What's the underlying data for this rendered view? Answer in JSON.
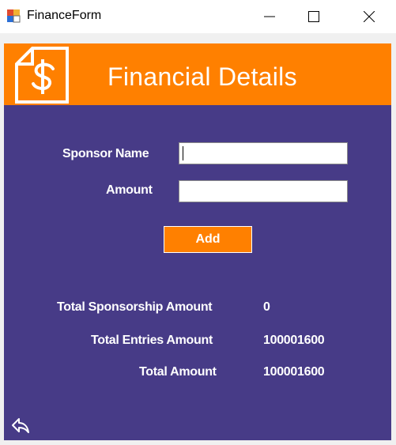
{
  "window": {
    "title": "FinanceForm",
    "controls": [
      "minimize",
      "maximize",
      "close"
    ]
  },
  "header": {
    "title": "Financial Details",
    "icon": "dollar-document-icon",
    "color": "#ff8000"
  },
  "form": {
    "background": "#473b87",
    "sponsor_name_label": "Sponsor Name",
    "sponsor_name_value": "",
    "amount_label": "Amount",
    "amount_value": "",
    "add_button_label": "Add"
  },
  "summary": {
    "total_sponsorship_label": "Total Sponsorship Amount",
    "total_sponsorship_value": "0",
    "total_entries_label": "Total Entries Amount",
    "total_entries_value": "100001600",
    "total_amount_label": "Total Amount",
    "total_amount_value": "100001600"
  },
  "footer": {
    "back_icon": "back-arrow-icon"
  }
}
